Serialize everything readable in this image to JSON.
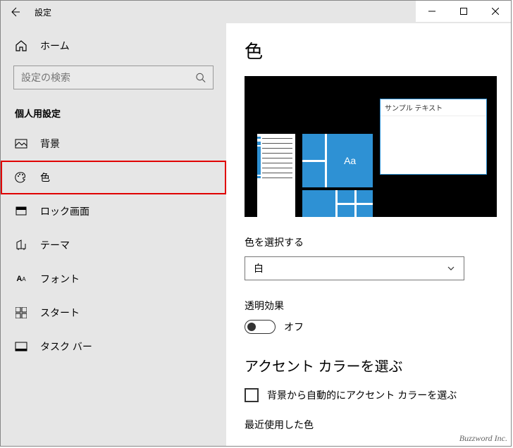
{
  "titlebar": {
    "title": "設定"
  },
  "sidebar": {
    "home": "ホーム",
    "search_placeholder": "設定の検索",
    "category": "個人用設定",
    "items": [
      {
        "label": "背景"
      },
      {
        "label": "色"
      },
      {
        "label": "ロック画面"
      },
      {
        "label": "テーマ"
      },
      {
        "label": "フォント"
      },
      {
        "label": "スタート"
      },
      {
        "label": "タスク バー"
      }
    ]
  },
  "main": {
    "title": "色",
    "preview_sample": "サンプル テキスト",
    "preview_aa": "Aa",
    "color_select_label": "色を選択する",
    "color_select_value": "白",
    "transparency_label": "透明効果",
    "transparency_state": "オフ",
    "accent_title": "アクセント カラーを選ぶ",
    "auto_accent_label": "背景から自動的にアクセント カラーを選ぶ",
    "recent_label": "最近使用した色"
  },
  "watermark": "Buzzword Inc."
}
